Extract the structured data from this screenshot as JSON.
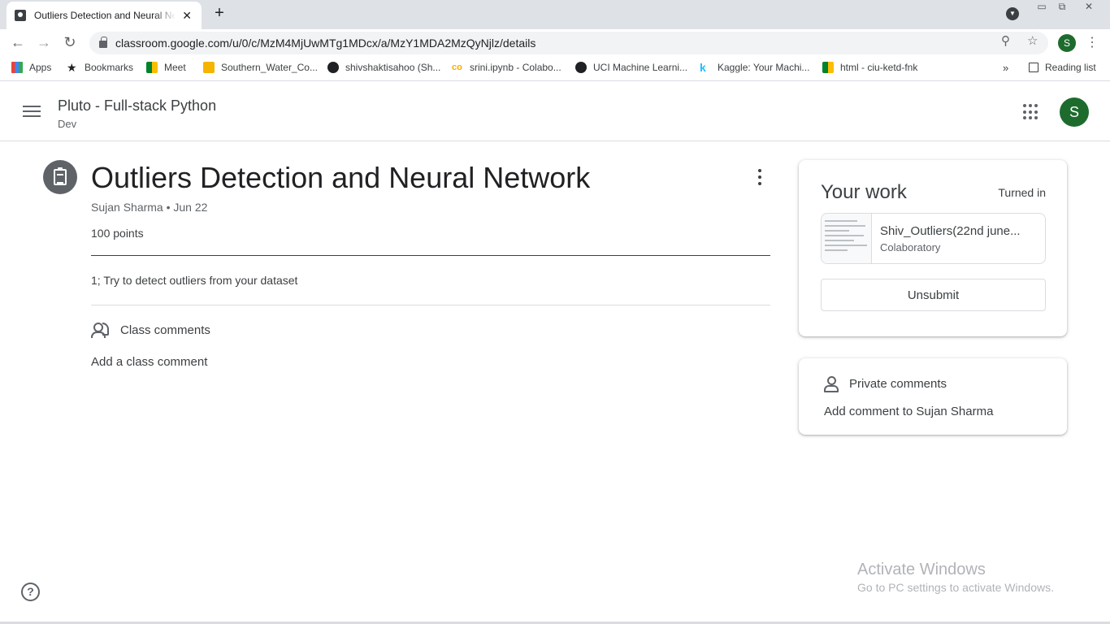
{
  "browser": {
    "tab_title": "Outliers Detection and Neural Network",
    "new_tab_symbol": "+",
    "close_symbol": "✕",
    "url": "classroom.google.com/u/0/c/MzM4MjUwMTg1MDcx/a/MzY1MDA2MzQyNjlz/details",
    "profile_initial": "S",
    "bookmarks": [
      {
        "label": "Apps",
        "icon": "apps-grid-icon"
      },
      {
        "label": "Bookmarks",
        "icon": "star-icon"
      },
      {
        "label": "Meet",
        "icon": "meet-icon"
      },
      {
        "label": "Southern_Water_Co...",
        "icon": "slides-icon"
      },
      {
        "label": "shivshaktisahoo (Sh...",
        "icon": "github-icon"
      },
      {
        "label": "srini.ipynb - Colabo...",
        "icon": "colab-icon"
      },
      {
        "label": "UCI Machine Learni...",
        "icon": "globe-icon"
      },
      {
        "label": "Kaggle: Your Machi...",
        "icon": "kaggle-icon"
      },
      {
        "label": "html - ciu-ketd-fnk",
        "icon": "meet-icon"
      }
    ],
    "bookmarks_overflow": "»",
    "reading_list": "Reading list"
  },
  "classroom": {
    "class_name": "Pluto - Full-stack Python",
    "section": "Dev",
    "avatar_initial": "S"
  },
  "assignment": {
    "title": "Outliers Detection and Neural Network",
    "meta": "Sujan Sharma • Jun 22",
    "points": "100 points",
    "instructions": "1; Try to detect outliers from your dataset",
    "class_comments_label": "Class comments",
    "add_class_comment": "Add a class comment"
  },
  "your_work": {
    "heading": "Your work",
    "status": "Turned in",
    "attachment_name": "Shiv_Outliers(22nd june...",
    "attachment_type": "Colaboratory",
    "unsubmit_label": "Unsubmit"
  },
  "private_comments": {
    "heading": "Private comments",
    "add_label": "Add comment to Sujan Sharma"
  },
  "help_symbol": "?",
  "watermark": {
    "title": "Activate Windows",
    "subtitle": "Go to PC settings to activate Windows."
  },
  "colors": {
    "accent_green": "#1e6b2e",
    "text_primary": "#3c4043",
    "text_secondary": "#5f6368",
    "divider": "#dadce0"
  }
}
